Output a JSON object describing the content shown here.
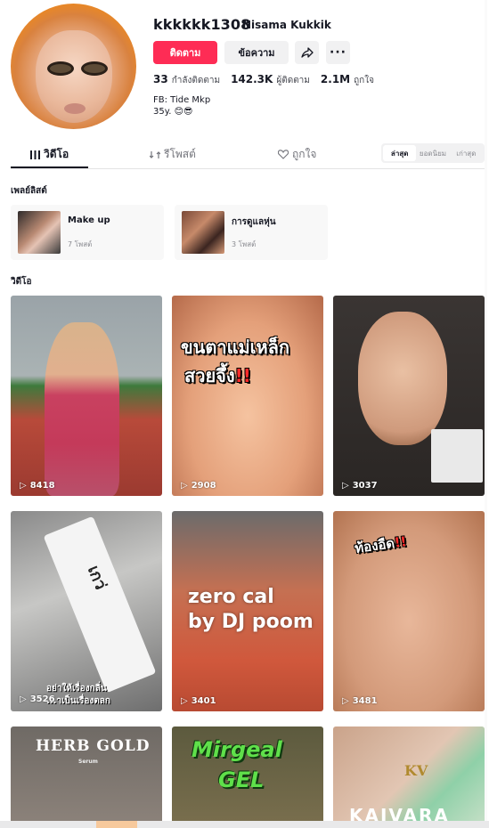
{
  "profile": {
    "username": "kkkkkk1308",
    "nickname": "Nisama Kukkik",
    "follow_label": "ติดตาม",
    "message_label": "ข้อความ",
    "stats": [
      {
        "value": "33",
        "label": "กำลังติดตาม"
      },
      {
        "value": "142.3K",
        "label": "ผู้ติดตาม"
      },
      {
        "value": "2.1M",
        "label": "ถูกใจ"
      }
    ],
    "bio_line1": "FB: Tide Mkp",
    "bio_line2": "35y. 😊😎"
  },
  "tabs": [
    {
      "label": "วิดีโอ",
      "icon": "grid-icon"
    },
    {
      "label": "รีโพสต์",
      "icon": "repost-icon"
    },
    {
      "label": "ถูกใจ",
      "icon": "heart-lock-icon"
    }
  ],
  "sort_options": [
    "ล่าสุด",
    "ยอดนิยม",
    "เก่าสุด"
  ],
  "playlists": {
    "title": "เพลย์ลิสต์",
    "items": [
      {
        "name": "Make up",
        "count": "7 โพสต์"
      },
      {
        "name": "การดูแลหุ่น",
        "count": "3 โพสต์"
      }
    ]
  },
  "videos": {
    "title": "วิดีโอ",
    "items": [
      {
        "views": "8418"
      },
      {
        "views": "2908",
        "overlay_line1": "ขนตาแม่เหล็ก",
        "overlay_line2": "สวยจึ้ง",
        "overlay_mark": "!!"
      },
      {
        "views": "3037"
      },
      {
        "views": "3526",
        "overlay_line1": "อย่าให้เรื่องกลิ่น",
        "overlay_line2": "...าเป็นเรื่องตลก",
        "overlay_extra": "เกว่"
      },
      {
        "views": "3401",
        "overlay_line1": "zero cal",
        "overlay_line2": "by DJ poom"
      },
      {
        "views": "3481",
        "overlay_line1": "ท้องอืด",
        "overlay_mark": "!!"
      },
      {
        "overlay_line1": "HERB GOLD",
        "overlay_line2": "Serum"
      },
      {
        "overlay_line1": "Mirgeal",
        "overlay_line2": "GEL"
      },
      {
        "overlay_line1": "KV",
        "overlay_line2": "KAIVARA"
      }
    ]
  },
  "colors": {
    "accent": "#fe2c55",
    "text": "#161823",
    "muted": "#8a8b91"
  }
}
